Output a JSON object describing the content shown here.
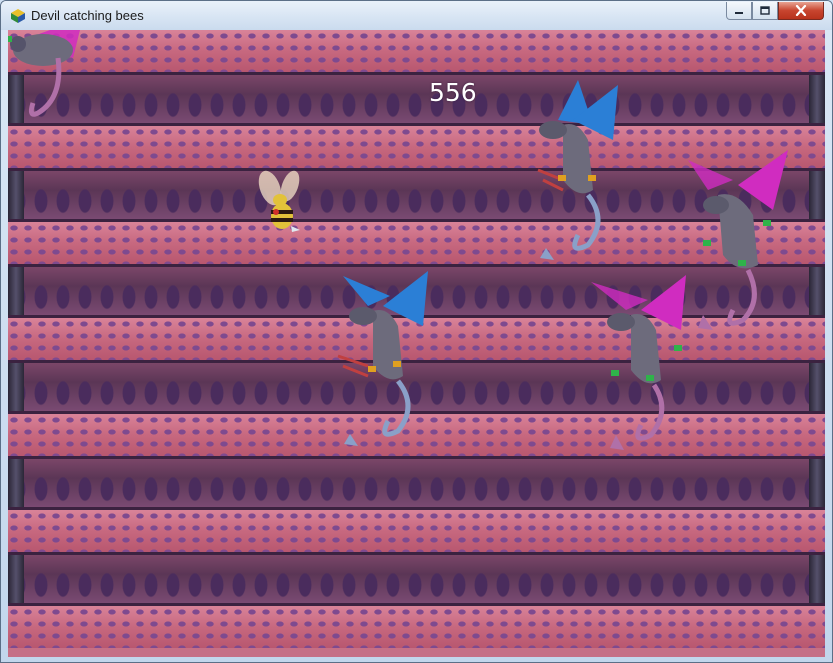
{
  "window": {
    "title": "Devil catching bees",
    "controls": {
      "minimize_icon": "minimize-icon",
      "maximize_icon": "maximize-icon",
      "close_icon": "close-icon"
    }
  },
  "game": {
    "score": "556",
    "colors": {
      "floor": "#c96e86",
      "arch": "#5b3656",
      "dragon_body": "#6d6b7c",
      "wing_blue": "#2b7fd6",
      "wing_magenta": "#d02cc0",
      "bee_body": "#e2c23a"
    },
    "sprites": [
      {
        "kind": "dragon",
        "variant": "magenta-wing"
      },
      {
        "kind": "dragon",
        "variant": "blue-wing"
      },
      {
        "kind": "dragon",
        "variant": "magenta-wing"
      },
      {
        "kind": "dragon",
        "variant": "blue-wing"
      },
      {
        "kind": "dragon",
        "variant": "magenta-wing"
      },
      {
        "kind": "bee",
        "variant": "player"
      }
    ]
  }
}
